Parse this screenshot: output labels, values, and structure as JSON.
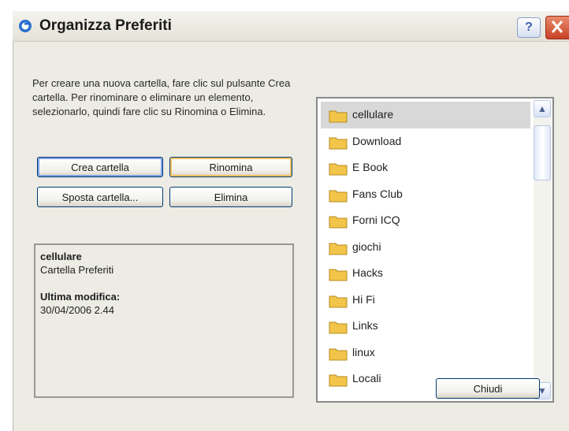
{
  "window": {
    "title": "Organizza Preferiti",
    "help_label": "?",
    "close_label": "✕"
  },
  "instructions": "Per creare una nuova cartella, fare clic sul pulsante Crea cartella. Per rinominare o eliminare un elemento, selezionarlo, quindi fare clic su Rinomina o Elimina.",
  "buttons": {
    "create_folder": "Crea cartella",
    "rename": "Rinomina",
    "move_folder": "Sposta cartella...",
    "delete": "Elimina",
    "close": "Chiudi"
  },
  "info": {
    "name": "cellulare",
    "type": "Cartella Preferiti",
    "modified_label": "Ultima modifica:",
    "modified_value": "30/04/2006 2.44"
  },
  "folders": {
    "items": [
      {
        "label": "cellulare",
        "selected": true
      },
      {
        "label": "Download"
      },
      {
        "label": "E Book"
      },
      {
        "label": "Fans Club"
      },
      {
        "label": "Forni ICQ"
      },
      {
        "label": "giochi"
      },
      {
        "label": "Hacks"
      },
      {
        "label": "Hi Fi"
      },
      {
        "label": "Links"
      },
      {
        "label": "linux"
      },
      {
        "label": "Locali"
      }
    ]
  },
  "scrollbar": {
    "up_label": "▲",
    "down_label": "▼"
  },
  "colors": {
    "folder": "#f2c54a",
    "selection": "#d8d8d8",
    "close_button": "#c94126"
  }
}
